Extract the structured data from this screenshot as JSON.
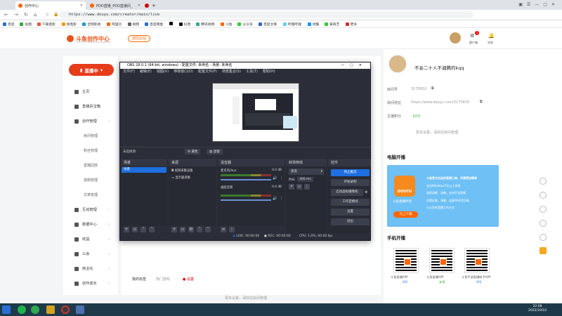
{
  "browser": {
    "tabs": [
      {
        "label": "创作中心",
        "active": true
      },
      {
        "label": "PDD直播_PDD直播间_",
        "active": false
      },
      {
        "label": "",
        "active": false
      }
    ],
    "new_tab_icon": "plus-icon",
    "url": "https://www.douyu.com/creator/main/live",
    "bookmarks": [
      "百度",
      "总图",
      "下载电影",
      "搜电影",
      "全网影视",
      "阿里云",
      "视频",
      "百度网盘",
      "",
      "抖音",
      "腾讯视频",
      "斗鱼",
      "公众号",
      "百度文库",
      "哔哩哔哩",
      "优酷",
      "爱奇艺",
      "更多"
    ]
  },
  "header": {
    "logo_text": "斗鱼创作中心",
    "logo_sub": "DOUYU CREATOR CENTER",
    "back_button": "返回主站",
    "icons": [
      "avatar",
      "bell-icon"
    ],
    "icon_labels": [
      "客户端",
      "消息"
    ],
    "badge": "1"
  },
  "sidebar": {
    "live_button": "直播中",
    "items": [
      {
        "label": "主页",
        "sub": []
      },
      {
        "label": "直播百宝箱",
        "sub": []
      },
      {
        "label": "创作管理",
        "sub": [
          "房间管理",
          "粉丝管理",
          "直播回放",
          "视频管理",
          "文章管理"
        ]
      },
      {
        "label": "互动管理",
        "sub": []
      },
      {
        "label": "数据中心",
        "sub": []
      },
      {
        "label": "收益",
        "sub": []
      },
      {
        "label": "公会",
        "sub": []
      },
      {
        "label": "商业化",
        "sub": []
      },
      {
        "label": "创作成长",
        "sub": []
      }
    ]
  },
  "main_bottom": {
    "links": [
      "我的标签",
      "热门游戏",
      "设置"
    ],
    "footer": "更多设置，请前往房间管理"
  },
  "obs": {
    "title": "OBS 28.0.1 (64-bit, windows) - 配置文件: 未命名 - 场景: 未命名",
    "menu": [
      "文件(F)",
      "编辑(E)",
      "视图(V)",
      "停靠窗口(D)",
      "配置文件(P)",
      "场景集合(S)",
      "工具(T)",
      "帮助(H)"
    ],
    "no_source_selected": "未选择源",
    "properties_button": "属性",
    "filters_button": "滤镜",
    "docks": {
      "scenes": {
        "title": "场景",
        "items": [
          "场景"
        ]
      },
      "sources": {
        "title": "来源",
        "items": [
          "视频采集设备",
          "显示器采集"
        ]
      },
      "mixer": {
        "title": "混音器",
        "channels": [
          {
            "name": "麦克风/Aux",
            "db": "0.0 dB"
          },
          {
            "name": "桌面音频",
            "db": "0.0 dB"
          }
        ]
      },
      "transitions": {
        "title": "转场特效",
        "type": "渐变",
        "duration_label": "时长",
        "duration": "300 ms"
      },
      "controls": {
        "title": "控件",
        "buttons": [
          "停止推流",
          "开始录制",
          "启动虚拟摄像机",
          "工作室模式",
          "设置",
          "退出"
        ]
      }
    },
    "status": {
      "live": "LIVE: 00:00:00",
      "rec": "REC: 00:00:00",
      "cpu": "CPU: 1.0%, 60.00 fps"
    }
  },
  "right_panel": {
    "username": "不亲二十人不调腾的kqq",
    "fields": [
      {
        "label": "房间号",
        "value": "3175810"
      },
      {
        "label": "房间地址",
        "value": "https://www.douyu.com/3175810"
      },
      {
        "label": "主播积分",
        "value": "10分"
      }
    ],
    "more_settings": "更多设置，请前往房间管理",
    "pc_section_title": "电脑开播",
    "promo": {
      "brand": "DOUYU",
      "app_name": "斗鱼直播伴侣",
      "button": "马上下载",
      "lines": [
        "斗鱼官方出品的直播工具，开播更加简单",
        "支持Windows7及以上系统",
        "画质清晰、流畅，支持手游直播",
        "内置礼物、弹幕、连麦PK多项功能",
        "与斗鱼的直播工作方式"
      ]
    },
    "mobile_section_title": "手机开播",
    "qrcodes": [
      {
        "label": "斗鱼直播APP",
        "platform": "iOS"
      },
      {
        "label": "斗鱼直播APP",
        "platform": "安卓"
      },
      {
        "label": "斗鱼手游直播助手APP",
        "platform": "iOS"
      }
    ]
  },
  "taskbar": {
    "time": "22:08",
    "date": "2022/10/10"
  },
  "colors": {
    "accent": "#e63c1a",
    "obs_bg": "#2b2e38",
    "primary_blue": "#1e6fe0"
  }
}
